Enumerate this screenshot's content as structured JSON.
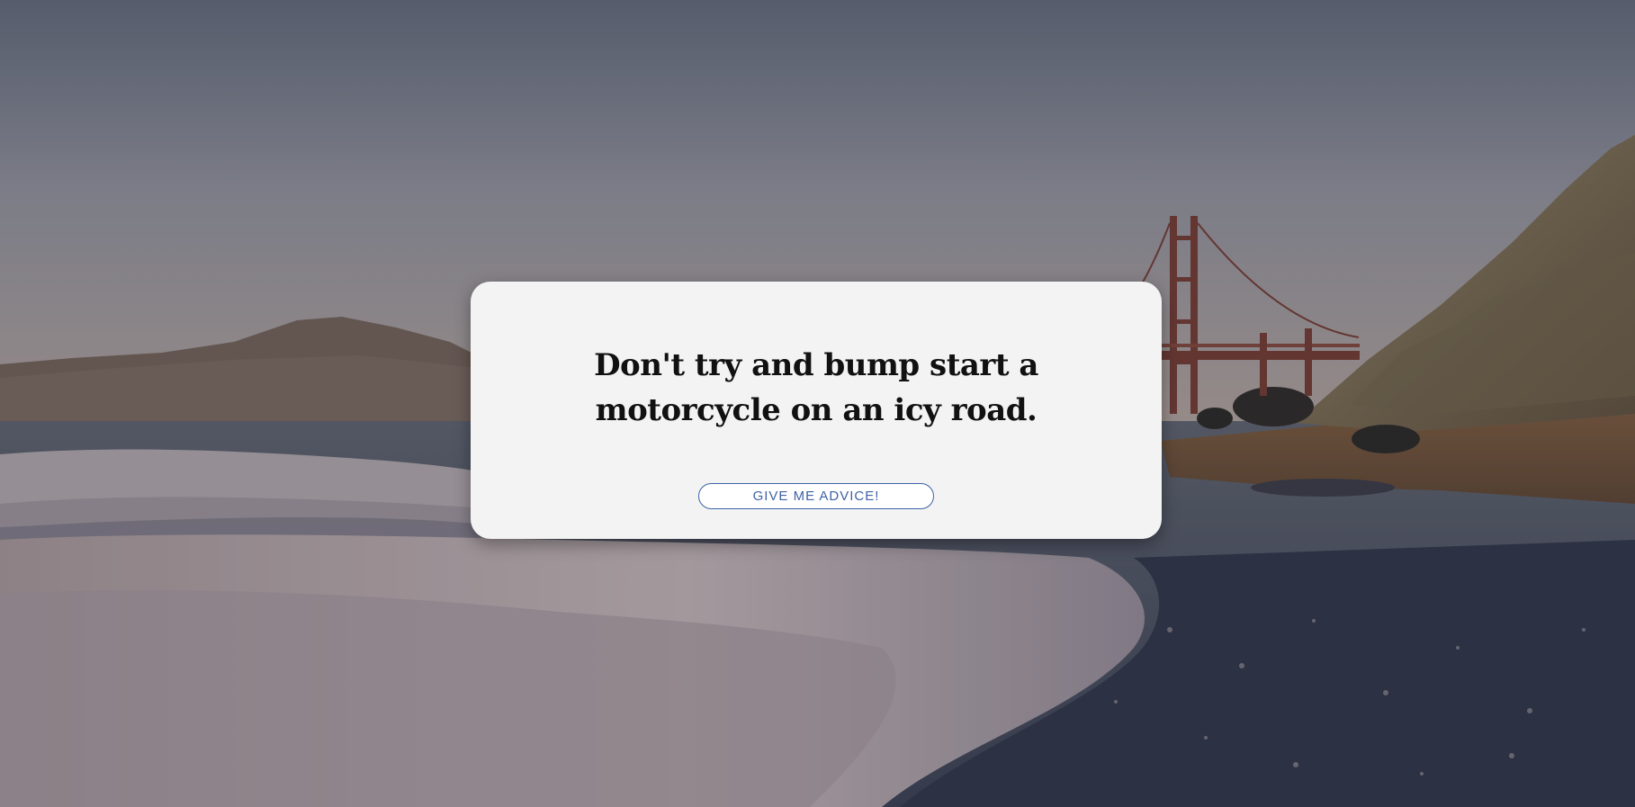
{
  "advice": {
    "text": "Don't try and bump start a motorcycle on an icy road."
  },
  "button": {
    "label": "GIVE ME ADVICE!"
  },
  "colors": {
    "card_background": "#f3f3f3",
    "button_accent": "#3f63a6",
    "text": "#111111"
  }
}
